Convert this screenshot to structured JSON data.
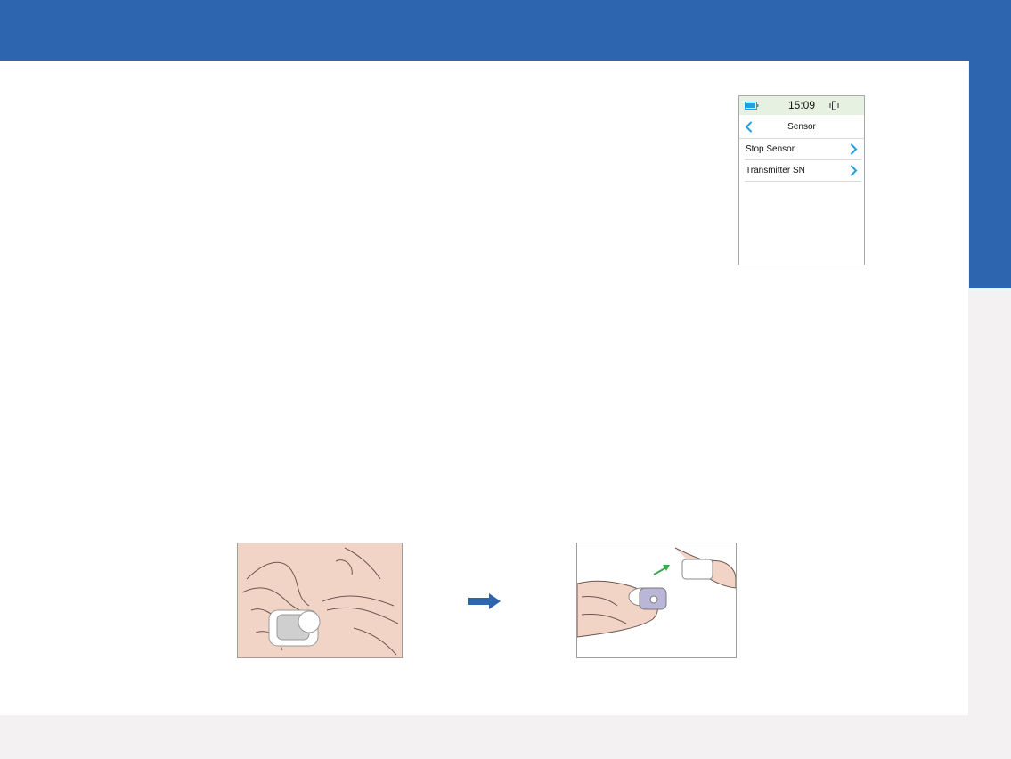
{
  "device_screen": {
    "time": "15:09",
    "title": "Sensor",
    "menu": [
      {
        "label": "Stop Sensor"
      },
      {
        "label": "Transmitter SN"
      }
    ]
  },
  "icons": {
    "battery": "battery-icon",
    "vibrate": "vibrate-icon",
    "back": "chevron-left-icon",
    "item": "chevron-right-icon",
    "step_arrow": "arrow-right-icon"
  },
  "colors": {
    "banner": "#2d66ae",
    "accent": "#1fa0e0",
    "status_bar": "#e6f1e1",
    "skin": "#f2d4c6",
    "green_arrow": "#3bab4a"
  }
}
